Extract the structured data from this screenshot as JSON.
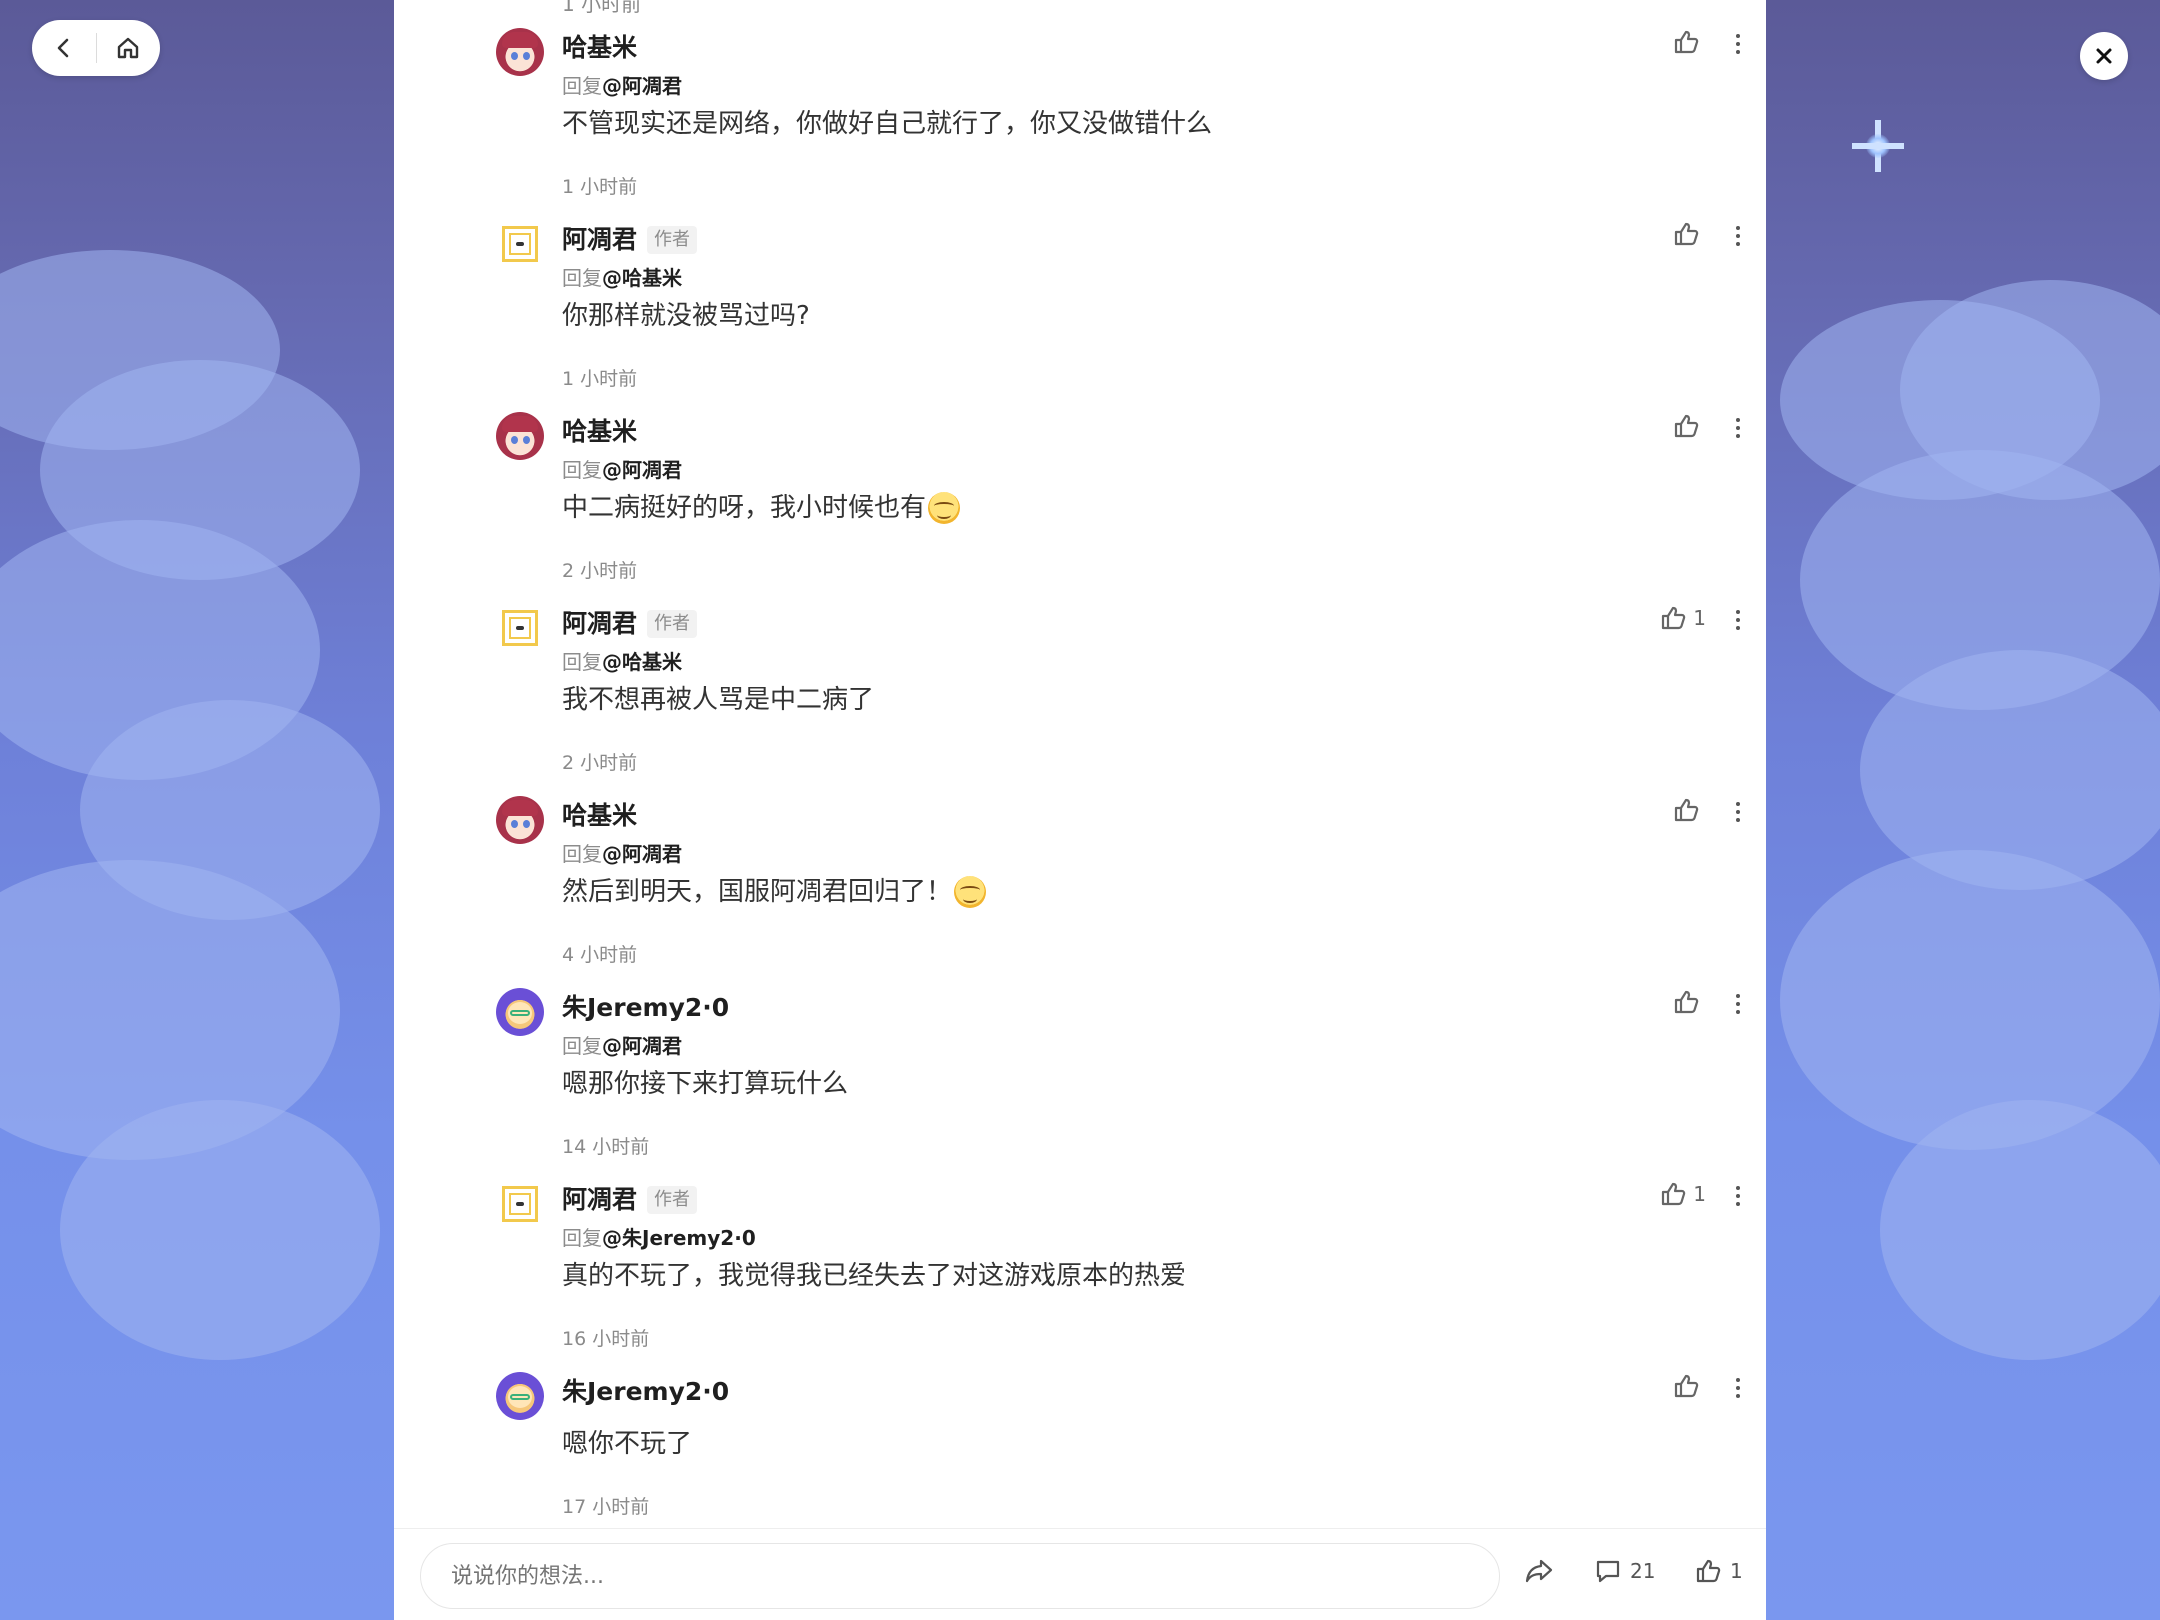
{
  "nav": {
    "back_icon": "chevron-left-icon",
    "home_icon": "home-icon",
    "close_icon": "close-icon"
  },
  "previous_time": "1 小时前",
  "reply_prefix": "回复",
  "comments": [
    {
      "user": "哈基米",
      "avatar": "hajimi",
      "is_author": false,
      "reply_to": "@阿凋君",
      "text": "不管现实还是网络，你做好自己就行了，你又没做错什么",
      "emoji": false,
      "time": "1 小时前",
      "likes": ""
    },
    {
      "user": "阿凋君",
      "avatar": "author",
      "is_author": true,
      "badge": "作者",
      "reply_to": "@哈基米",
      "text": "你那样就没被骂过吗?",
      "emoji": false,
      "time": "1 小时前",
      "likes": ""
    },
    {
      "user": "哈基米",
      "avatar": "hajimi",
      "is_author": false,
      "reply_to": "@阿凋君",
      "text": "中二病挺好的呀，我小时候也有",
      "emoji": true,
      "time": "2 小时前",
      "likes": ""
    },
    {
      "user": "阿凋君",
      "avatar": "author",
      "is_author": true,
      "badge": "作者",
      "reply_to": "@哈基米",
      "text": "我不想再被人骂是中二病了",
      "emoji": false,
      "time": "2 小时前",
      "likes": "1"
    },
    {
      "user": "哈基米",
      "avatar": "hajimi",
      "is_author": false,
      "reply_to": "@阿凋君",
      "text": "然后到明天，国服阿凋君回归了！",
      "emoji": true,
      "time": "4 小时前",
      "likes": ""
    },
    {
      "user": "朱Jeremy2·0",
      "avatar": "jeremy",
      "is_author": false,
      "reply_to": "@阿凋君",
      "text": "嗯那你接下来打算玩什么",
      "emoji": false,
      "time": "14 小时前",
      "likes": ""
    },
    {
      "user": "阿凋君",
      "avatar": "author",
      "is_author": true,
      "badge": "作者",
      "reply_to": "@朱Jeremy2·0",
      "text": "真的不玩了，我觉得我已经失去了对这游戏原本的热爱",
      "emoji": false,
      "time": "16 小时前",
      "likes": "1"
    },
    {
      "user": "朱Jeremy2·0",
      "avatar": "jeremy",
      "is_author": false,
      "reply_to": "",
      "text": "嗯你不玩了",
      "emoji": false,
      "time": "17 小时前",
      "likes": ""
    }
  ],
  "bottom": {
    "placeholder": "说说你的想法...",
    "comment_count": "21",
    "like_count": "1"
  }
}
